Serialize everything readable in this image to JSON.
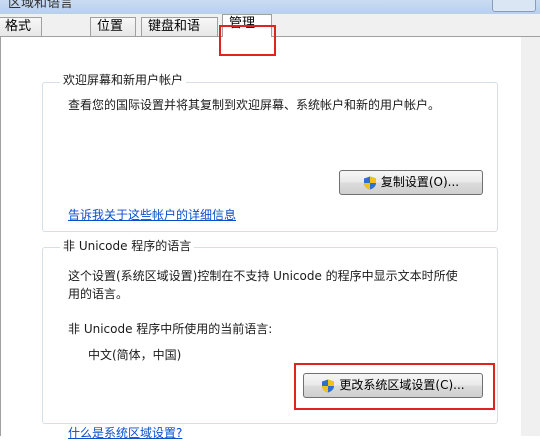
{
  "window": {
    "title": "区域和语言"
  },
  "tabs": [
    {
      "label": "格式"
    },
    {
      "label": "位置"
    },
    {
      "label": "键盘和语言"
    },
    {
      "label": "管理"
    }
  ],
  "welcome_group": {
    "legend": "欢迎屏幕和新用户帐户",
    "description": "查看您的国际设置并将其复制到欢迎屏幕、系统帐户和新的用户帐户。",
    "copy_button": "复制设置(O)...",
    "link": "告诉我关于这些帐户的详细信息"
  },
  "unicode_group": {
    "legend": "非 Unicode 程序的语言",
    "description_line1": "这个设置(系统区域设置)控制在不支持 Unicode 的程序中显示文本时所使",
    "description_line2": "用的语言。",
    "current_label": "非 Unicode 程序中所使用的当前语言:",
    "current_value": "中文(简体，中国)",
    "change_button": "更改系统区域设置(C)...",
    "link": "什么是系统区域设置?"
  },
  "colors": {
    "highlight": "#e0231e",
    "link": "#0a4ec9",
    "shield_blue": "#2f6fd0",
    "shield_yellow": "#f2c21b"
  }
}
